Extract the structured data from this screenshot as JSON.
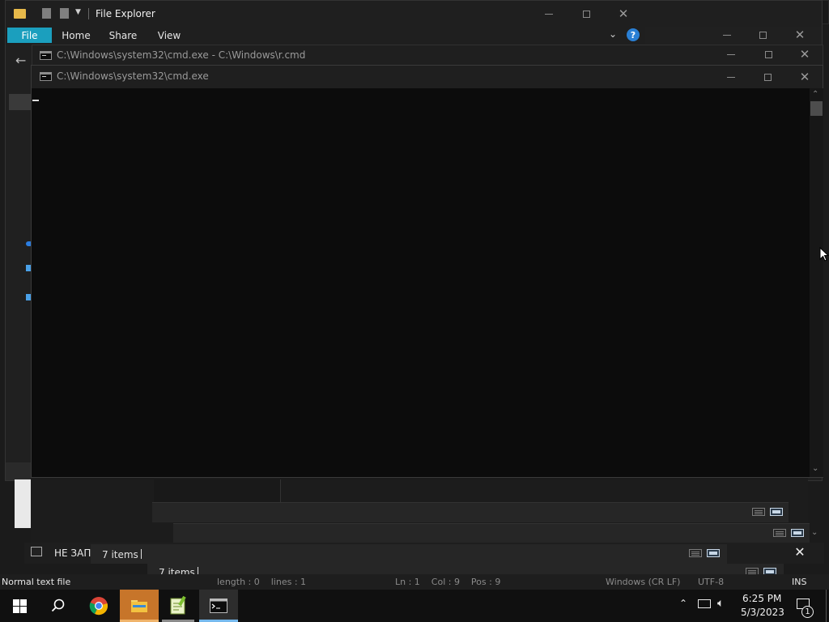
{
  "file_explorer": {
    "title": "File Explorer",
    "tabs": [
      "File",
      "Home",
      "Share",
      "View"
    ],
    "status_items_a": "7 items",
    "status_items_b": "7 items",
    "status_items_c": "7 items",
    "accent": "#1b9fbe"
  },
  "cmd_back": {
    "title": "C:\\Windows\\system32\\cmd.exe - C:\\Windows\\r.cmd"
  },
  "cmd_front": {
    "title": "C:\\Windows\\system32\\cmd.exe"
  },
  "notepad": {
    "status_left": "Normal text file",
    "status_length": "length : 0    lines : 1",
    "status_pos": "Ln : 1    Col : 9    Pos : 9",
    "status_eol": "Windows (CR LF)",
    "status_enc": "UTF-8",
    "status_ins": "INS"
  },
  "partial_window": {
    "label": "НЕ ЗАП"
  },
  "taskbar": {
    "time": "6:25 PM",
    "date": "5/3/2023",
    "notification_count": "1",
    "icons": [
      "windows-start-icon",
      "search-icon",
      "chrome-icon",
      "file-explorer-icon",
      "notepad-plus-plus-icon",
      "cmd-icon"
    ]
  }
}
